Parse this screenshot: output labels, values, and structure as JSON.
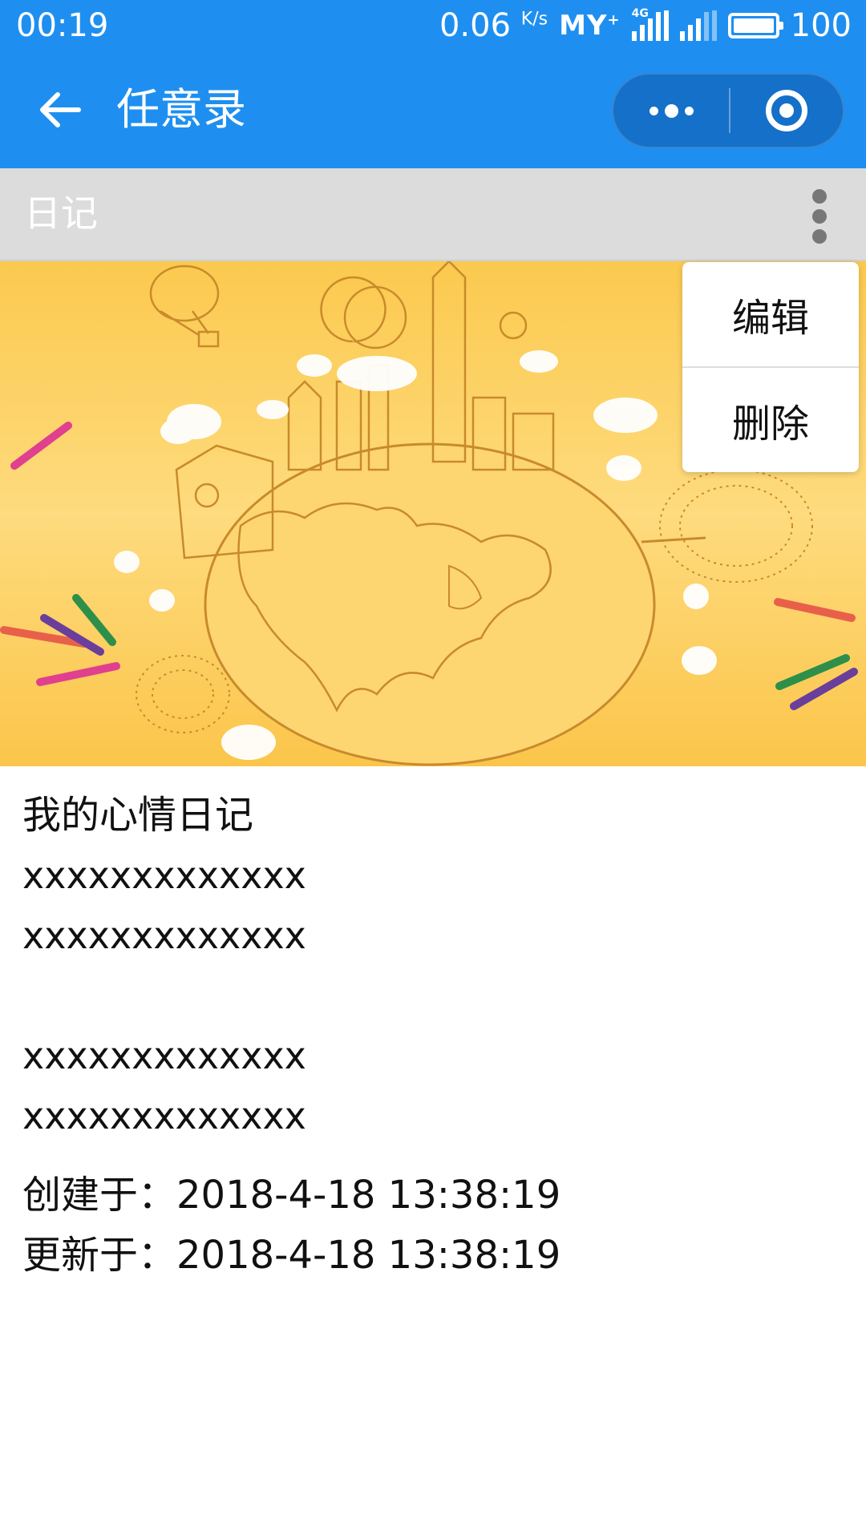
{
  "status_bar": {
    "time": "00:19",
    "net_speed": "0.06",
    "net_unit": "K/s",
    "carrier": "MY",
    "carrier_plus": "+",
    "network_type": "4G",
    "battery": "100"
  },
  "nav": {
    "title": "任意录",
    "back_icon": "arrow-left-icon",
    "more_icon": "more-dots-icon",
    "close_icon": "target-circle-icon"
  },
  "section": {
    "title": "日记",
    "menu_icon": "vertical-dots-icon"
  },
  "menu": {
    "items": [
      {
        "label": "编辑"
      },
      {
        "label": "删除"
      }
    ]
  },
  "diary": {
    "title": "我的心情日记",
    "lines": [
      "xxxxxxxxxxxxx",
      "xxxxxxxxxxxxx",
      "",
      "xxxxxxxxxxxxx",
      "xxxxxxxxxxxxx"
    ],
    "created": "创建于：2018-4-18 13:38:19",
    "updated": "更新于：2018-4-18 13:38:19"
  },
  "colors": {
    "primary": "#1e8ff0",
    "section_bg": "#dcdcdc",
    "banner_bg": "#fdd36a"
  }
}
